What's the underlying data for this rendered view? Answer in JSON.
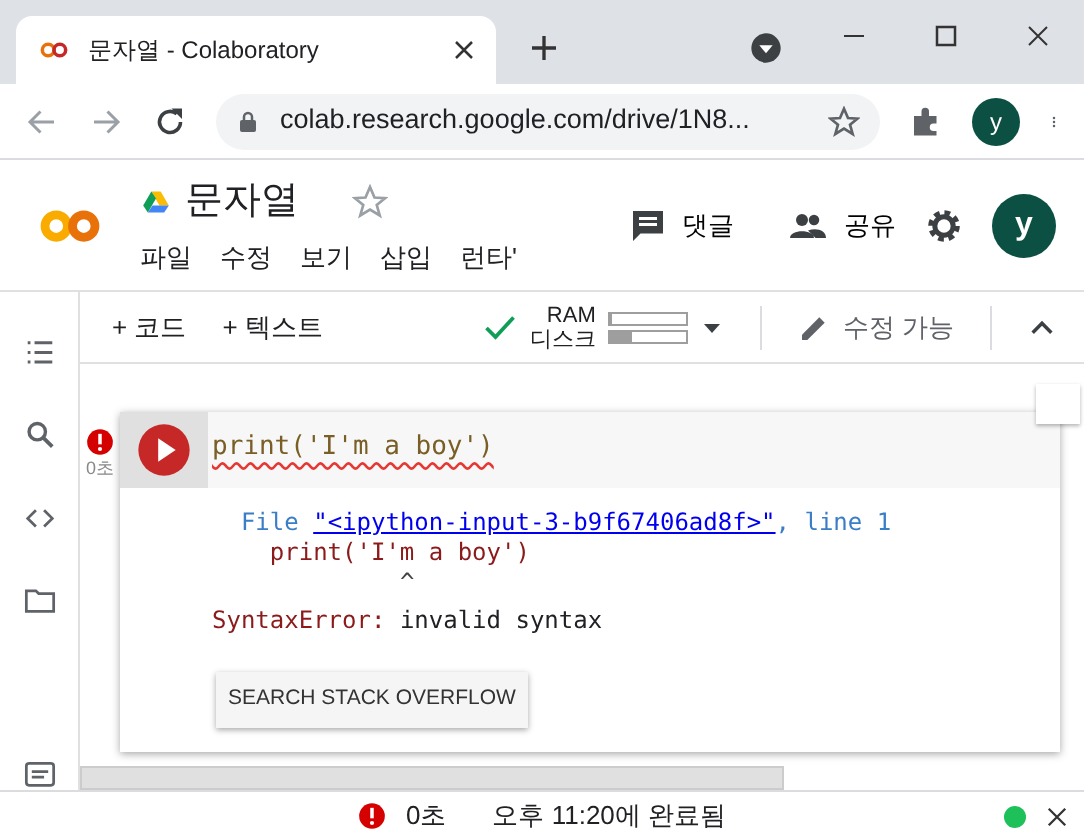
{
  "browser": {
    "tab_title": "문자열 - Colaboratory",
    "url": "colab.research.google.com/drive/1N8...",
    "avatar": "y"
  },
  "notebook": {
    "title": "문자열",
    "starred": false,
    "menu": [
      "파일",
      "수정",
      "보기",
      "삽입",
      "런타'"
    ],
    "comment": "댓글",
    "share": "공유",
    "avatar": "y"
  },
  "toolbar": {
    "add_code": "+ 코드",
    "add_text": "+ 텍스트",
    "connected": true,
    "ram": {
      "label": "RAM",
      "level": 0.03
    },
    "disk": {
      "label": "디스크",
      "level": 0.3
    },
    "edit": "수정 가능"
  },
  "cell": {
    "code": "print('I'm a boy')",
    "error": true,
    "time": "0초",
    "traceback": {
      "file_prefix": "File",
      "file_link": "\"<ipython-input-3-b9f67406ad8f>\"",
      "line": ", line 1",
      "code_line": "print('I'm a boy')",
      "caret": "^",
      "error_name": "SyntaxError:",
      "error_msg": "invalid syntax"
    },
    "button": "SEARCH STACK OVERFLOW"
  },
  "status_bar": {
    "error": true,
    "time": "0초",
    "message": "오후 11:20에 완료됨",
    "connected": true
  }
}
